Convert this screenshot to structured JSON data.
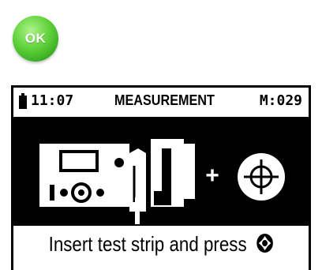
{
  "ok_button": {
    "label": "OK",
    "color": "#4cc42a"
  },
  "status_bar": {
    "time": "11:07",
    "title": "MEASUREMENT",
    "memory": "M:029",
    "battery_icon": "battery-icon"
  },
  "illustration": {
    "plus": "+",
    "meter_icon": "meter-with-strip-icon",
    "button_icon": "crosshair-button-icon"
  },
  "prompt": {
    "text": "Insert test strip and press",
    "icon": "crosshair-button-icon"
  }
}
